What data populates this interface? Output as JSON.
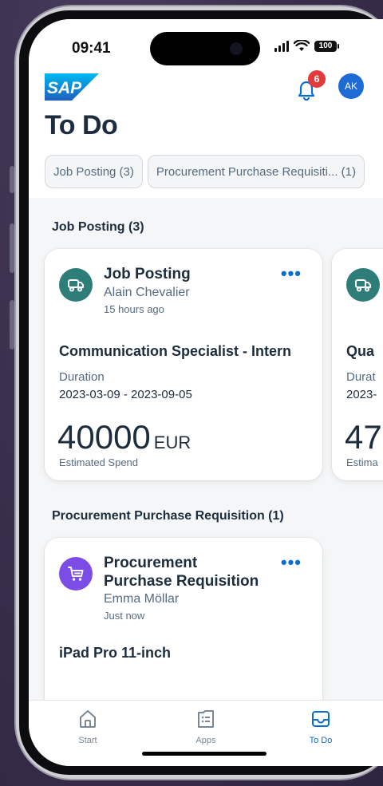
{
  "status_bar": {
    "time": "09:41",
    "battery": "100"
  },
  "header": {
    "notifications_count": "6",
    "avatar_initials": "AK",
    "page_title": "To Do"
  },
  "filter_chips": [
    {
      "label": "Job Posting (3)"
    },
    {
      "label": "Procurement Purchase Requisiti... (1)"
    }
  ],
  "sections": [
    {
      "title": "Job Posting (3)",
      "cards": [
        {
          "type": "Job Posting",
          "user": "Alain Chevalier",
          "time": "15 hours ago",
          "headline": "Communication Specialist - Intern",
          "field_label": "Duration",
          "field_value": "2023-03-09 - 2023-09-05",
          "amount": "40000",
          "currency": "EUR",
          "amount_label": "Estimated Spend"
        },
        {
          "headline": "Qua",
          "field_label": "Durat",
          "field_value": "2023-",
          "amount": "47",
          "amount_label": "Estima"
        }
      ]
    },
    {
      "title": "Procurement Purchase Requisition (1)",
      "cards": [
        {
          "type_line1": "Procurement",
          "type_line2": "Purchase Requisition",
          "user": "Emma Möllar",
          "time": "Just now",
          "headline": "iPad Pro 11-inch"
        }
      ]
    }
  ],
  "tab_bar": [
    {
      "label": "Start",
      "icon": "home-icon"
    },
    {
      "label": "Apps",
      "icon": "apps-list-icon"
    },
    {
      "label": "To Do",
      "icon": "inbox-icon",
      "active": true
    }
  ],
  "colors": {
    "accent": "#0a6ed1",
    "job_icon_bg": "#2e7d78",
    "procurement_icon_bg": "#7b4ce6",
    "badge": "#e33b3b"
  }
}
